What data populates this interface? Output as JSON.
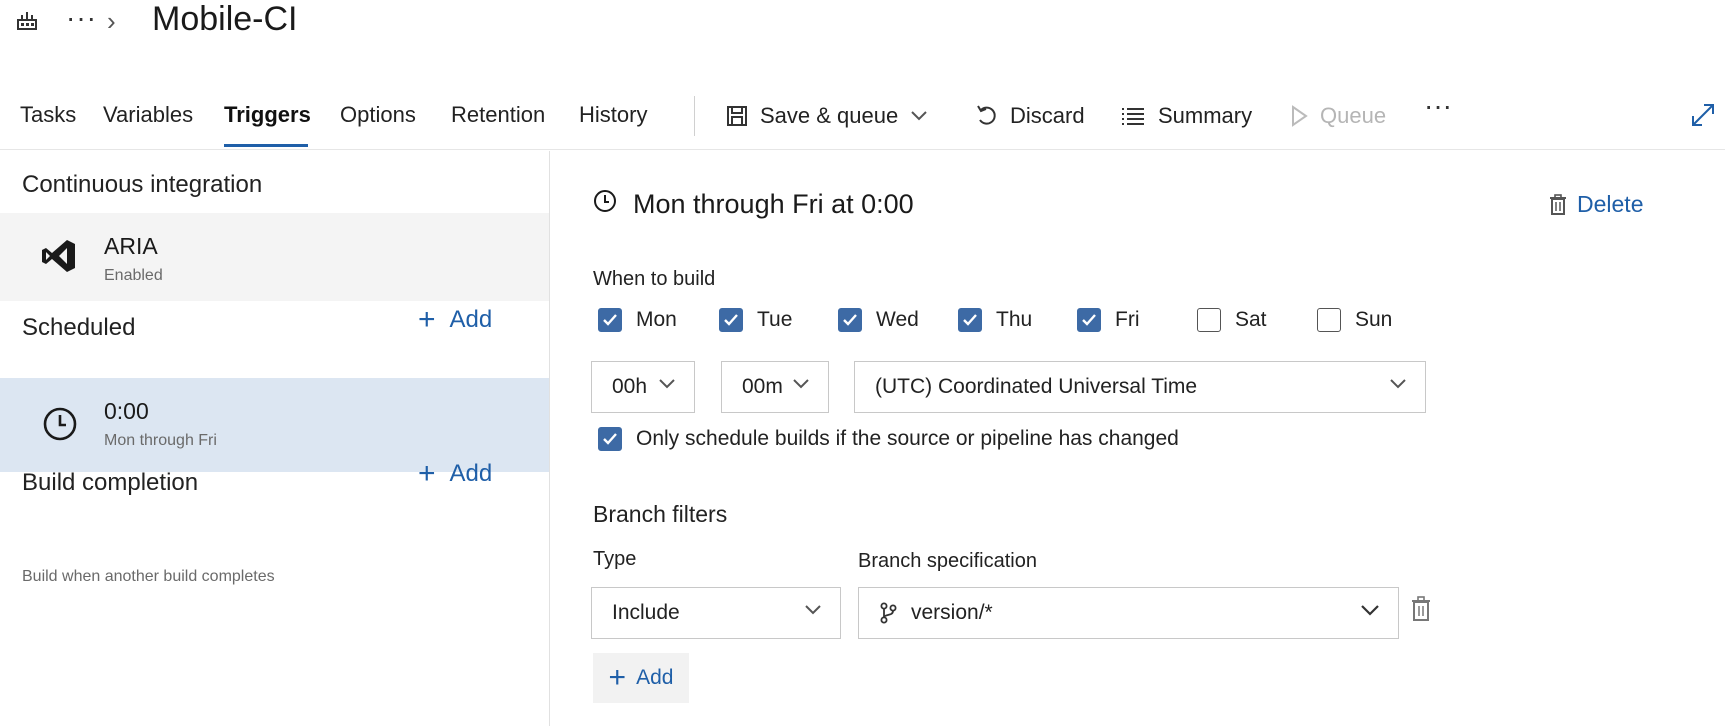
{
  "header": {
    "title": "Mobile-CI",
    "more": "···",
    "chevron": "›"
  },
  "toolbar": {
    "tabs": [
      {
        "label": "Tasks"
      },
      {
        "label": "Variables"
      },
      {
        "label": "Triggers"
      },
      {
        "label": "Options"
      },
      {
        "label": "Retention"
      },
      {
        "label": "History"
      }
    ],
    "active_tab": "Triggers",
    "save_queue": "Save & queue",
    "discard": "Discard",
    "summary": "Summary",
    "queue": "Queue",
    "more": "···"
  },
  "left": {
    "ci_section": "Continuous integration",
    "ci_item": {
      "name": "ARIA",
      "status": "Enabled"
    },
    "scheduled_section": "Scheduled",
    "add_label": "Add",
    "sched_item": {
      "name": "0:00",
      "sub": "Mon through Fri"
    },
    "build_completion_section": "Build completion",
    "build_completion_help": "Build when another build completes"
  },
  "right": {
    "title": "Mon through Fri at 0:00",
    "delete_label": "Delete",
    "when_to_build": "When to build",
    "days": [
      {
        "label": "Mon",
        "checked": true
      },
      {
        "label": "Tue",
        "checked": true
      },
      {
        "label": "Wed",
        "checked": true
      },
      {
        "label": "Thu",
        "checked": true
      },
      {
        "label": "Fri",
        "checked": true
      },
      {
        "label": "Sat",
        "checked": false
      },
      {
        "label": "Sun",
        "checked": false
      }
    ],
    "hour": "00h",
    "minute": "00m",
    "timezone": "(UTC) Coordinated Universal Time",
    "only_changed": {
      "label": "Only schedule builds if the source or pipeline has changed",
      "checked": true
    },
    "branch_filters": "Branch filters",
    "type_label": "Type",
    "branch_spec_label": "Branch specification",
    "type_value": "Include",
    "branch_value": "version/*",
    "add_label": "Add"
  },
  "colors": {
    "accent": "#1f5fa8",
    "checkbox": "#3d6aa5",
    "selected_row": "#dce6f2"
  }
}
